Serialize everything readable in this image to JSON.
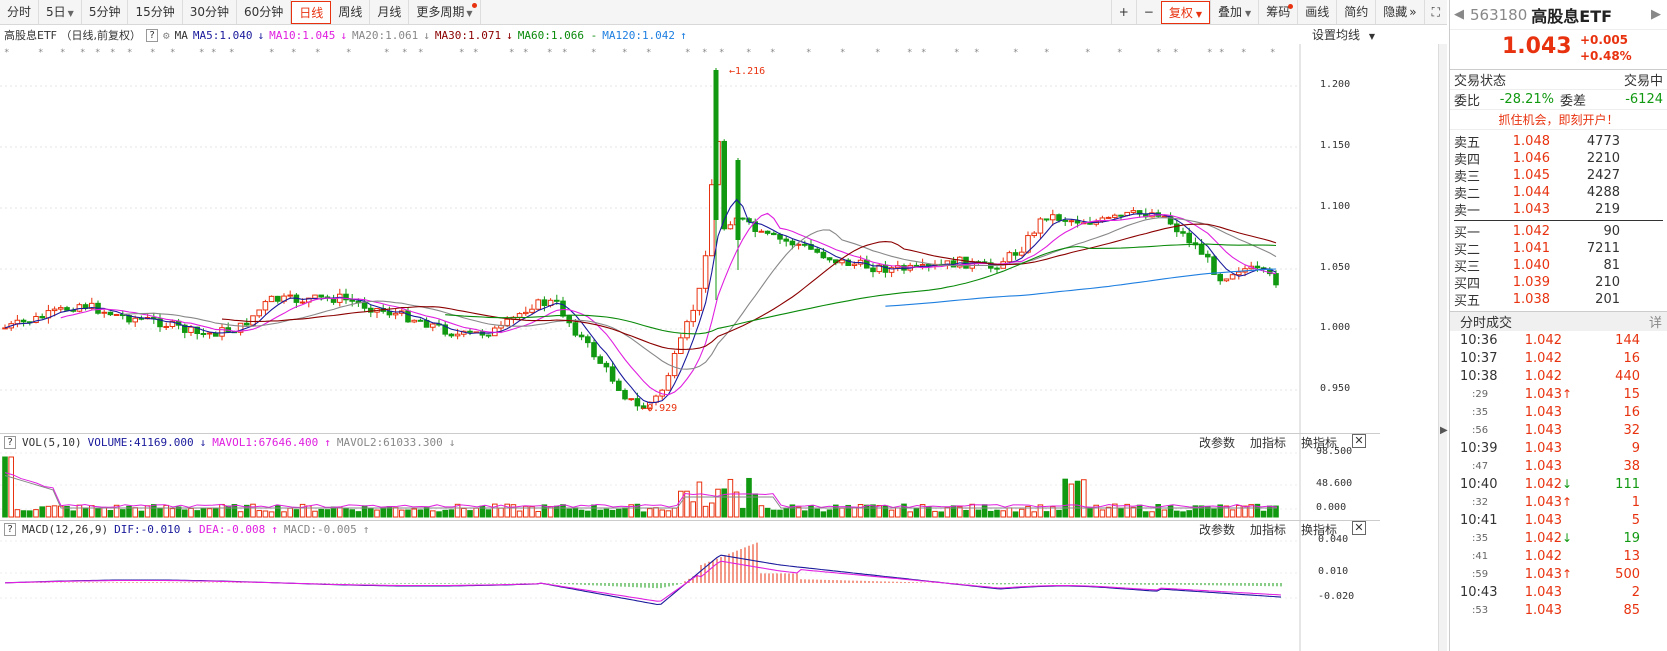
{
  "toolbar": {
    "periods": [
      "分时",
      "5日",
      "5分钟",
      "15分钟",
      "30分钟",
      "60分钟",
      "日线",
      "周线",
      "月线",
      "更多周期"
    ],
    "active_period": "日线",
    "tools": [
      "+",
      "−",
      "复权",
      "叠加",
      "筹码",
      "画线",
      "简约",
      "隐藏"
    ],
    "hide_arrow": "»",
    "corner_icon": "⛶"
  },
  "ma_line": {
    "title": "高股息ETF （日线,前复权）",
    "help": "?",
    "ma_label": "MA",
    "ma5": "MA5:1.040",
    "ma10": "MA10:1.045",
    "ma20": "MA20:1.061",
    "ma30": "MA30:1.071",
    "ma60": "MA60:1.066 -",
    "ma120": "MA120:1.042",
    "set_ma": "设置均线"
  },
  "price_axis": [
    "1.200",
    "1.150",
    "1.100",
    "1.050",
    "1.000",
    "0.950"
  ],
  "annotations": {
    "high": "1.216",
    "low": "0.929"
  },
  "vol_panel": {
    "label": "VOL(5,10)",
    "volume": "VOLUME:41169.000",
    "mavol1": "MAVOL1:67646.400",
    "mavol2": "MAVOL2:61033.300",
    "axis": [
      "98.500",
      "48.600",
      "0.000"
    ]
  },
  "macd_panel": {
    "label": "MACD(12,26,9)",
    "dif": "DIF:-0.010",
    "dea": "DEA:-0.008",
    "macd": "MACD:-0.005",
    "axis": [
      "0.040",
      "0.010",
      "-0.020"
    ]
  },
  "panel_buttons": {
    "params": "改参数",
    "add": "加指标",
    "swap": "换指标",
    "close": "✕"
  },
  "colors": {
    "up": "#e8320f",
    "down": "#119911",
    "ma5": "#1a1a9c",
    "ma10": "#e020e0",
    "ma20": "#888888",
    "ma30": "#8b0000",
    "ma60": "#0a8a0a",
    "ma120": "#1f7fe0"
  },
  "quote": {
    "code": "563180",
    "name": "高股息ETF",
    "price": "1.043",
    "change": "+0.005",
    "change_pct": "+0.48%",
    "status_label": "交易状态",
    "status": "交易中",
    "wb_label": "委比",
    "wb": "-28.21%",
    "wc_label": "委差",
    "wc": "-6124",
    "promo": "抓住机会，即刻开户！"
  },
  "orderbook": {
    "sells": [
      {
        "label": "卖五",
        "price": "1.048",
        "vol": "4773"
      },
      {
        "label": "卖四",
        "price": "1.046",
        "vol": "2210"
      },
      {
        "label": "卖三",
        "price": "1.045",
        "vol": "2427"
      },
      {
        "label": "卖二",
        "price": "1.044",
        "vol": "4288"
      },
      {
        "label": "卖一",
        "price": "1.043",
        "vol": "219"
      }
    ],
    "buys": [
      {
        "label": "买一",
        "price": "1.042",
        "vol": "90"
      },
      {
        "label": "买二",
        "price": "1.041",
        "vol": "7211"
      },
      {
        "label": "买三",
        "price": "1.040",
        "vol": "81"
      },
      {
        "label": "买四",
        "price": "1.039",
        "vol": "210"
      },
      {
        "label": "买五",
        "price": "1.038",
        "vol": "201"
      }
    ]
  },
  "ticks_header": {
    "title": "分时成交",
    "detail": "详"
  },
  "ticks": [
    {
      "time": "10:36",
      "price": "1.042",
      "arrow": "",
      "vol": "144",
      "sub": false
    },
    {
      "time": "10:37",
      "price": "1.042",
      "arrow": "",
      "vol": "16",
      "sub": false
    },
    {
      "time": "10:38",
      "price": "1.042",
      "arrow": "",
      "vol": "440",
      "sub": false
    },
    {
      "time": ":29",
      "price": "1.043",
      "arrow": "up",
      "vol": "15",
      "sub": true
    },
    {
      "time": ":35",
      "price": "1.043",
      "arrow": "",
      "vol": "16",
      "sub": true
    },
    {
      "time": ":56",
      "price": "1.043",
      "arrow": "",
      "vol": "32",
      "sub": true
    },
    {
      "time": "10:39",
      "price": "1.043",
      "arrow": "",
      "vol": "9",
      "sub": false
    },
    {
      "time": ":47",
      "price": "1.043",
      "arrow": "",
      "vol": "38",
      "sub": true
    },
    {
      "time": "10:40",
      "price": "1.042",
      "arrow": "down",
      "vol": "111",
      "sub": false
    },
    {
      "time": ":32",
      "price": "1.043",
      "arrow": "up",
      "vol": "1",
      "sub": true
    },
    {
      "time": "10:41",
      "price": "1.043",
      "arrow": "",
      "vol": "5",
      "sub": false
    },
    {
      "time": ":35",
      "price": "1.042",
      "arrow": "down",
      "vol": "19",
      "sub": true
    },
    {
      "time": ":41",
      "price": "1.042",
      "arrow": "",
      "vol": "13",
      "sub": true
    },
    {
      "time": ":59",
      "price": "1.043",
      "arrow": "up",
      "vol": "500",
      "sub": true
    },
    {
      "time": "10:43",
      "price": "1.043",
      "arrow": "",
      "vol": "2",
      "sub": false
    },
    {
      "time": ":53",
      "price": "1.043",
      "arrow": "",
      "vol": "85",
      "sub": true
    }
  ]
}
